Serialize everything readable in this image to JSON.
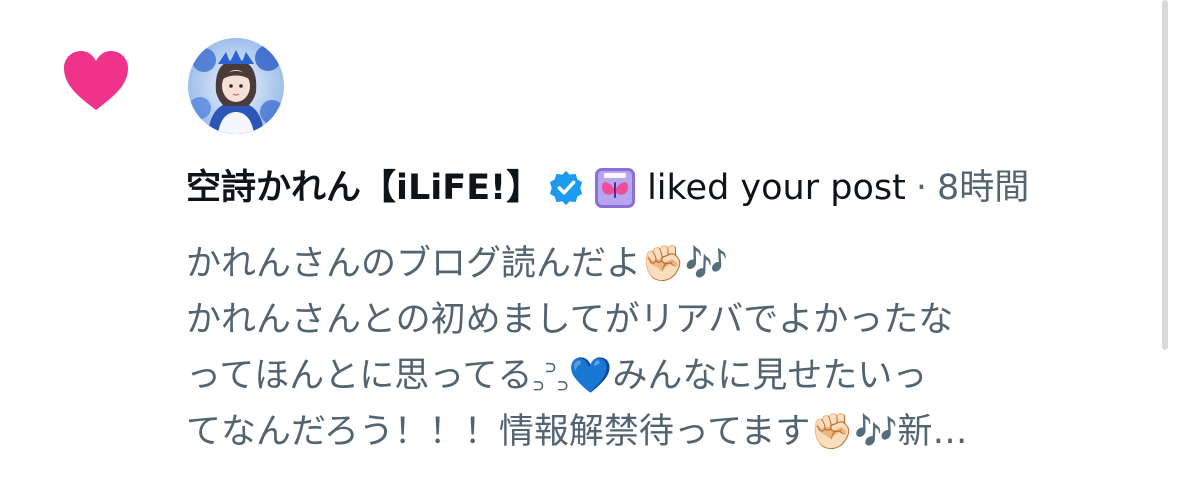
{
  "notification": {
    "type_icon": "heart-icon",
    "type_icon_color": "#f0338a",
    "avatar": "user-avatar",
    "user": {
      "display_name": "空詩かれん【iLiFE!】",
      "verified_icon": "verified-badge-icon",
      "verified_color": "#1d9bf0",
      "affiliate_icon": "iLiFE-affiliate-badge-icon"
    },
    "action_text": "liked your post",
    "separator": "·",
    "timestamp": "8時間",
    "post_preview": {
      "lines": [
        "かれんさんのブログ読んだよ✊🏻🎶",
        "かれんさんとの初めましてがリアバでよかったな",
        "ってほんとに思ってる꜆꜄꜆💙みんなに見せたいっ",
        "てなんだろう！！！情報解禁待ってます✊🏻🎶新…"
      ]
    }
  },
  "colors": {
    "primary_text": "#0f1419",
    "secondary_text": "#536471"
  }
}
